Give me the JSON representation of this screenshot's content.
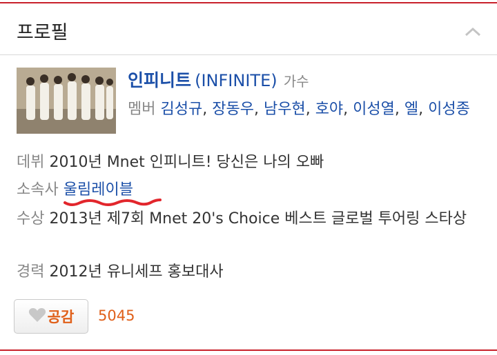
{
  "header": {
    "title": "프로필"
  },
  "artist": {
    "name": "인피니트",
    "name_en": "(INFINITE)",
    "role": "가수",
    "members_label": "멤버",
    "members": [
      "김성규",
      "장동우",
      "남우현",
      "호야",
      "이성열",
      "엘",
      "이성종"
    ]
  },
  "info": {
    "debut_label": "데뷔",
    "debut_value": "2010년 Mnet 인피니트! 당신은 나의 오빠",
    "agency_label": "소속사",
    "agency_value": "울림레이블",
    "award_label": "수상",
    "award_value": "2013년 제7회 Mnet 20's Choice 베스트 글로벌 투어링 스타상",
    "career_label": "경력",
    "career_value": "2012년 유니세프 홍보대사"
  },
  "like": {
    "label": "공감",
    "count": "5045"
  },
  "colors": {
    "accent_red": "#c8202a",
    "link_blue": "#1b4fa8",
    "count_orange": "#e0601a"
  },
  "icons": [
    "chevron-up-icon",
    "heart-icon"
  ]
}
